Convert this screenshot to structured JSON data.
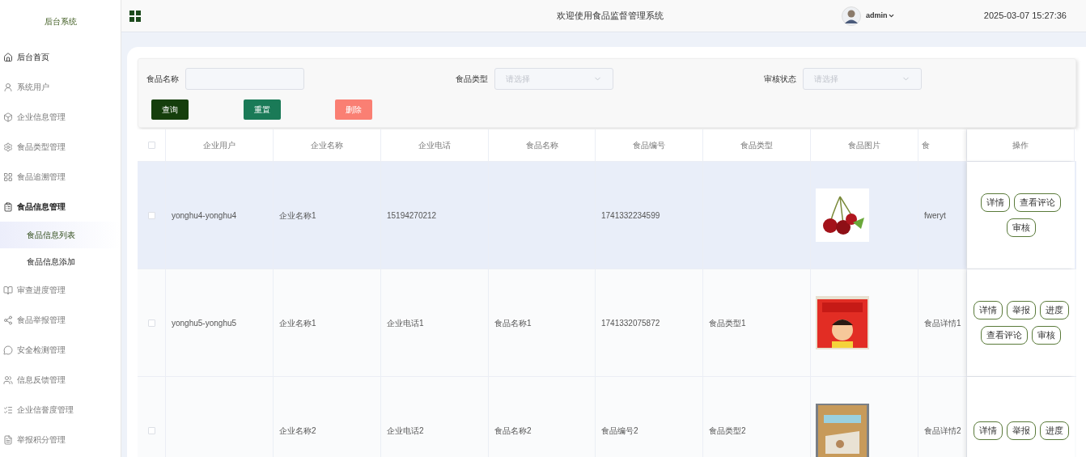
{
  "sidebar": {
    "title": "后台系统",
    "items": [
      {
        "label": "后台首页",
        "expanded": false
      },
      {
        "label": "系统用户",
        "expanded": false
      },
      {
        "label": "企业信息管理",
        "expanded": false
      },
      {
        "label": "食品类型管理",
        "expanded": false
      },
      {
        "label": "食品追溯管理",
        "expanded": false
      },
      {
        "label": "食品信息管理",
        "expanded": true,
        "children": [
          {
            "label": "食品信息列表",
            "selected": true
          },
          {
            "label": "食品信息添加",
            "selected": false
          }
        ]
      },
      {
        "label": "审查进度管理",
        "expanded": false
      },
      {
        "label": "食品举报管理",
        "expanded": false
      },
      {
        "label": "安全检测管理",
        "expanded": false
      },
      {
        "label": "信息反馈管理",
        "expanded": false
      },
      {
        "label": "企业信誉度管理",
        "expanded": false
      },
      {
        "label": "举报积分管理",
        "expanded": false
      }
    ]
  },
  "header": {
    "title": "欢迎使用食品监督管理系统",
    "user": "admin",
    "datetime": "2025-03-07 15:27:36"
  },
  "search": {
    "fields": [
      {
        "kind": "input",
        "label": "食品名称"
      },
      {
        "kind": "select",
        "label": "食品类型",
        "placeholder": "请选择"
      },
      {
        "kind": "select",
        "label": "审核状态",
        "placeholder": "请选择"
      }
    ],
    "buttons": [
      {
        "label": "查询",
        "kind": "primary"
      },
      {
        "label": "重置",
        "kind": "secondary"
      },
      {
        "label": "删除",
        "kind": "danger"
      }
    ]
  },
  "table": {
    "select_all_checked": false,
    "columns": [
      "企业用户",
      "企业名称",
      "企业电话",
      "食品名称",
      "食品编号",
      "食品类型",
      "食品图片",
      "食",
      "操作"
    ],
    "rows": [
      {
        "selected": true,
        "checked": false,
        "cells": [
          "yonghu4-yonghu4",
          "企业名称1",
          "15194270212",
          "",
          "1741332234599",
          "",
          "",
          "fweryt"
        ],
        "actions": [
          "详情",
          "查看评论",
          "审核"
        ]
      },
      {
        "selected": false,
        "checked": false,
        "cells": [
          "yonghu5-yonghu5",
          "企业名称1",
          "企业电话1",
          "食品名称1",
          "1741332075872",
          "食品类型1",
          "",
          "食品详情1"
        ],
        "actions": [
          "详情",
          "举报",
          "进度",
          "查看评论",
          "审核"
        ]
      },
      {
        "selected": false,
        "checked": false,
        "cells": [
          "",
          "企业名称2",
          "企业电话2",
          "食品名称2",
          "食品编号2",
          "食品类型2",
          "",
          "食品详情2"
        ],
        "actions": [
          "详情",
          "举报",
          "进度"
        ]
      }
    ]
  }
}
